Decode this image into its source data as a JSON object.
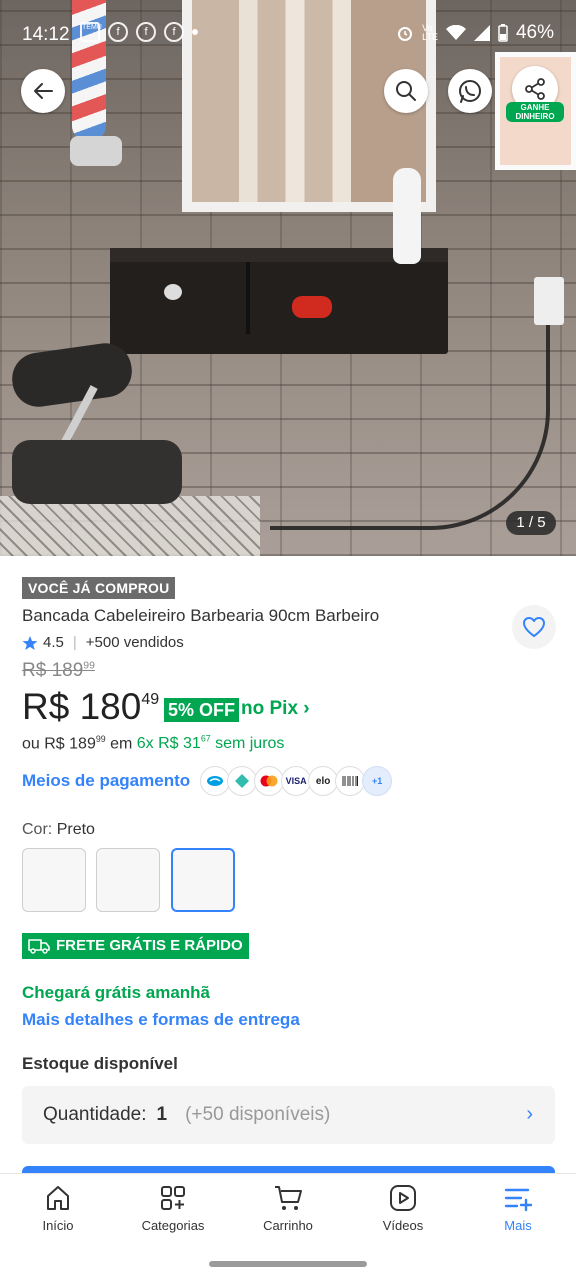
{
  "status_bar": {
    "time": "14:12",
    "battery": "46%",
    "icons": [
      "temu-icon",
      "facebook-icon",
      "facebook-icon",
      "facebook-icon",
      "dot-icon",
      "alarm-icon",
      "volte-icon",
      "wifi-icon",
      "signal-icon",
      "battery-icon"
    ]
  },
  "gallery": {
    "counter": "1 / 5",
    "share_caption": "GANHE DINHEIRO"
  },
  "product": {
    "bought_badge": "VOCÊ JÁ COMPROU",
    "title": "Bancada Cabeleireiro Barbearia 90cm Barbeiro",
    "rating": "4.5",
    "sold": "+500 vendidos",
    "old_price_main": "R$ 189",
    "old_price_cents": "99",
    "price_main": "R$ 180",
    "price_cents": "49",
    "discount": "5% OFF",
    "pix": "no Pix ›",
    "installment_prefix": "ou R$ 189",
    "installment_prefix_cents": "99",
    "installment_em": "em",
    "installment_green": "6x R$ 31",
    "installment_green_cents": "67",
    "installment_suffix": "sem juros",
    "payment_link": "Meios de pagamento",
    "payment_icons": [
      "VISA",
      "elo",
      "+1"
    ],
    "color_label": "Cor:",
    "color_value": "Preto"
  },
  "shipping": {
    "badge": "FRETE GRÁTIS E RÁPIDO",
    "arrival": "Chegará grátis amanhã",
    "details_link": "Mais detalhes e formas de entrega"
  },
  "stock": {
    "heading": "Estoque disponível",
    "quantity_label": "Quantidade:",
    "quantity_value": "1",
    "available": "(+50 disponíveis)"
  },
  "nav": {
    "items": [
      {
        "label": "Início"
      },
      {
        "label": "Categorias"
      },
      {
        "label": "Carrinho"
      },
      {
        "label": "Vídeos"
      },
      {
        "label": "Mais"
      }
    ],
    "active": "Mais"
  },
  "colors": {
    "accent_blue": "#3483fa",
    "green": "#00a650"
  }
}
